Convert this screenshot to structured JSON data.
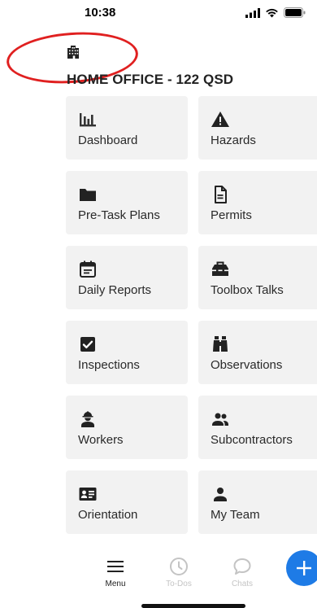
{
  "status_bar": {
    "time": "10:38",
    "icons": [
      "signal-icon",
      "wifi-icon",
      "battery-icon"
    ]
  },
  "site": {
    "icon": "building-icon",
    "name": "HOME OFFICE - 122 QSD"
  },
  "menu": [
    {
      "label": "Dashboard",
      "icon": "bar-chart-icon"
    },
    {
      "label": "Hazards",
      "icon": "warning-icon"
    },
    {
      "label": "Pre-Task Plans",
      "icon": "folder-icon"
    },
    {
      "label": "Permits",
      "icon": "document-icon"
    },
    {
      "label": "Daily Reports",
      "icon": "calendar-icon"
    },
    {
      "label": "Toolbox Talks",
      "icon": "toolbox-icon"
    },
    {
      "label": "Inspections",
      "icon": "checkbox-icon"
    },
    {
      "label": "Observations",
      "icon": "binoculars-icon"
    },
    {
      "label": "Workers",
      "icon": "worker-icon"
    },
    {
      "label": "Subcontractors",
      "icon": "people-icon"
    },
    {
      "label": "Orientation",
      "icon": "id-card-icon"
    },
    {
      "label": "My Team",
      "icon": "person-icon"
    }
  ],
  "bottom_nav": {
    "items": [
      {
        "label": "Menu",
        "icon": "hamburger-icon",
        "active": true
      },
      {
        "label": "To-Dos",
        "icon": "clock-icon",
        "active": false
      },
      {
        "label": "Chats",
        "icon": "chat-bubble-icon",
        "active": false
      }
    ],
    "fab_icon": "plus-icon"
  },
  "colors": {
    "accent": "#1e7be6",
    "annotation": "#e02020",
    "tile_bg": "#f2f2f2",
    "inactive": "#c4c4c4"
  }
}
